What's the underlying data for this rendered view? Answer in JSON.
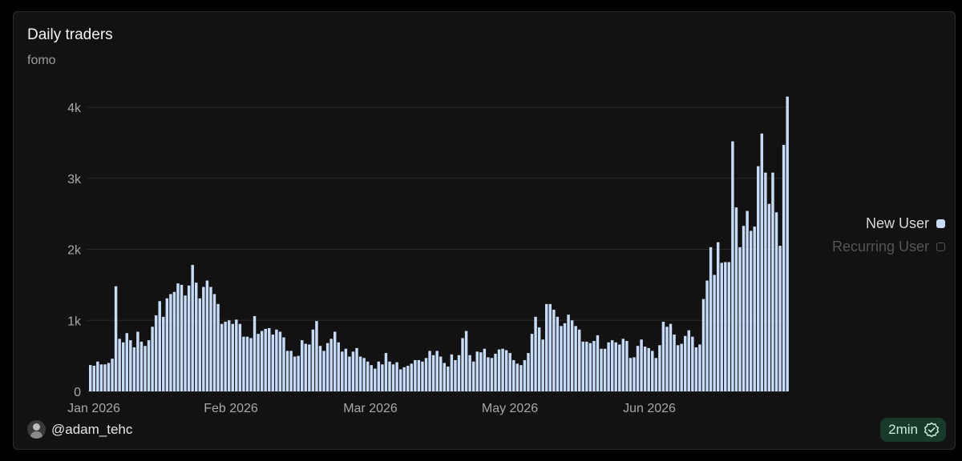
{
  "card": {
    "title": "Daily traders",
    "subtitle": "fomo",
    "author": "@adam_tehc",
    "refresh_badge": "2min"
  },
  "colors": {
    "new_user": "#c8dcf8",
    "recurring_user": "#555555",
    "background": "#121212",
    "grid": "#2a2a2a",
    "badge_bg": "#173a2a"
  },
  "icons": [
    "avatar",
    "verified-check-icon"
  ],
  "chart_data": {
    "type": "bar",
    "title": "Daily traders",
    "subtitle": "fomo",
    "stacked": true,
    "ylim": [
      0,
      4000
    ],
    "yticks": [
      0,
      1000,
      2000,
      3000,
      4000
    ],
    "ytick_labels": [
      "0",
      "1k",
      "2k",
      "3k",
      "4k"
    ],
    "xtick_labels": [
      "Jan 2026",
      "Feb 2026",
      "Mar 2026",
      "May 2026",
      "Jun 2026"
    ],
    "grid": "horizontal",
    "legend_position": "right",
    "legend": [
      "New User",
      "Recurring User"
    ],
    "series": [
      {
        "name": "New User",
        "values": [
          370,
          360,
          420,
          380,
          380,
          400,
          460,
          1480,
          740,
          690,
          820,
          720,
          620,
          840,
          700,
          640,
          720,
          910,
          1070,
          1270,
          1050,
          1310,
          1370,
          1400,
          1520,
          1500,
          1350,
          1490,
          1780,
          1530,
          1310,
          1470,
          1560,
          1470,
          1370,
          1230,
          950,
          980,
          1000,
          950,
          1010,
          950,
          770,
          770,
          750,
          1060,
          810,
          850,
          880,
          890,
          800,
          870,
          840,
          760,
          570,
          570,
          490,
          500,
          720,
          670,
          660,
          870,
          990,
          640,
          570,
          680,
          740,
          840,
          690,
          560,
          600,
          490,
          560,
          610,
          490,
          470,
          420,
          370,
          320,
          420,
          380,
          540,
          420,
          380,
          410,
          310,
          340,
          360,
          390,
          440,
          440,
          420,
          470,
          570,
          510,
          570,
          490,
          400,
          350,
          520,
          440,
          510,
          750,
          850,
          510,
          420,
          560,
          550,
          600,
          480,
          470,
          530,
          590,
          600,
          580,
          540,
          440,
          390,
          370,
          440,
          540,
          810,
          1050,
          900,
          730,
          1230,
          1230,
          1150,
          1050,
          920,
          960,
          1080,
          1000,
          920,
          870,
          700,
          700,
          680,
          710,
          790,
          600,
          600,
          690,
          720,
          690,
          660,
          740,
          710,
          470,
          480,
          640,
          730,
          630,
          610,
          570,
          470,
          650,
          980,
          910,
          950,
          800,
          650,
          670,
          780,
          860,
          770,
          620,
          660,
          1300,
          1560,
          2030,
          1640,
          2100,
          1810,
          1820,
          1820,
          3520,
          2590,
          2030,
          2330,
          2540,
          2260,
          2320,
          3170,
          3630,
          3080,
          2640,
          3080,
          2520,
          2050,
          3470,
          4150
        ]
      },
      {
        "name": "Recurring User",
        "values": []
      }
    ]
  }
}
